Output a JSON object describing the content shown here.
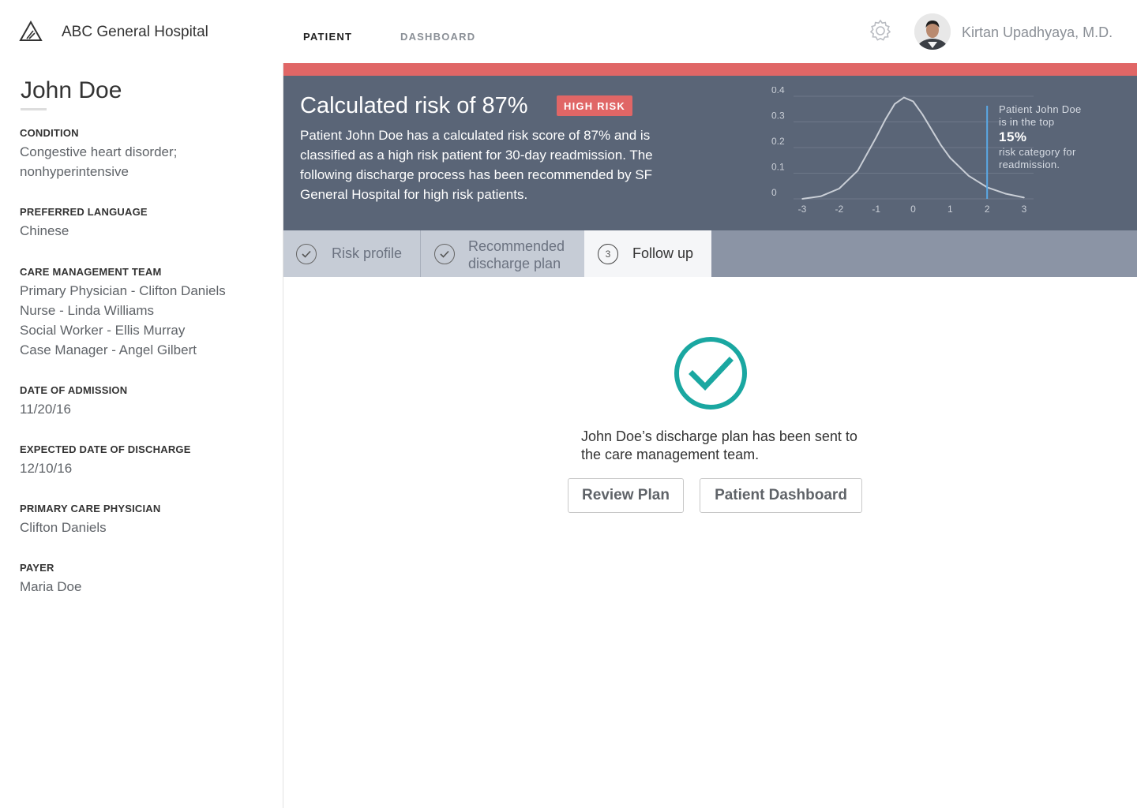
{
  "app": {
    "name": "ABC General Hospital",
    "logo_icon": "triangle-logo-icon"
  },
  "nav": {
    "tabs": [
      {
        "label": "PATIENT",
        "active": true
      },
      {
        "label": "DASHBOARD",
        "active": false
      }
    ]
  },
  "user": {
    "name": "Kirtan Upadhyaya, M.D.",
    "settings_icon": "gear-icon"
  },
  "patient": {
    "name": "John Doe",
    "fields": {
      "condition": {
        "label": "CONDITION",
        "lines": [
          "Congestive heart disorder;",
          "nonhyperintensive"
        ]
      },
      "language": {
        "label": "PREFERRED LANGUAGE",
        "value": "Chinese"
      },
      "care_team": {
        "label": "CARE MANAGEMENT TEAM",
        "lines": [
          "Primary Physician - Clifton Daniels",
          "Nurse - Linda Williams",
          "Social Worker - Ellis Murray",
          "Case Manager - Angel Gilbert"
        ]
      },
      "admission": {
        "label": "DATE OF ADMISSION",
        "value": "11/20/16"
      },
      "discharge": {
        "label": "EXPECTED DATE OF DISCHARGE",
        "value": "12/10/16"
      },
      "pcp": {
        "label": "PRIMARY CARE PHYSICIAN",
        "value": "Clifton Daniels"
      },
      "payer": {
        "label": "PAYER",
        "value": "Maria Doe"
      }
    }
  },
  "risk": {
    "title": "Calculated risk of 87%",
    "badge": "HIGH RISK",
    "description": "Patient John Doe has a calculated risk score of 87% and is classified as a high risk patient for 30-day readmission. The following discharge process has been recommended by SF General Hospital for high risk patients.",
    "annotation": {
      "line1": "Patient John Doe",
      "line2": "is in the top",
      "percent": "15%",
      "line3": "risk category for",
      "line4": "readmission."
    }
  },
  "chart_data": {
    "type": "line",
    "title": "",
    "xlabel": "",
    "ylabel": "",
    "x_ticks": [
      "-3",
      "-2",
      "-1",
      "0",
      "1",
      "2",
      "3"
    ],
    "y_ticks": [
      "0",
      "0.1",
      "0.2",
      "0.3",
      "0.4"
    ],
    "xlim": [
      -3,
      3
    ],
    "ylim": [
      0,
      0.4
    ],
    "x": [
      -3.0,
      -2.5,
      -2.0,
      -1.5,
      -1.0,
      -0.75,
      -0.5,
      -0.25,
      0.0,
      0.25,
      0.5,
      0.75,
      1.0,
      1.5,
      2.0,
      2.5,
      3.0
    ],
    "y": [
      0.0,
      0.01,
      0.04,
      0.11,
      0.24,
      0.31,
      0.37,
      0.395,
      0.38,
      0.33,
      0.27,
      0.21,
      0.16,
      0.09,
      0.045,
      0.02,
      0.005
    ],
    "marker_x": 2.0,
    "grid": true,
    "colors": {
      "line": "#c9ced6",
      "marker": "#5aa9e6",
      "axis_text": "#c9ced6"
    }
  },
  "steps": [
    {
      "label": "Risk profile",
      "status": "done",
      "icon": "check-circle-icon"
    },
    {
      "label_line1": "Recommended",
      "label_line2": "discharge plan",
      "status": "done",
      "icon": "check-circle-icon"
    },
    {
      "label": "Follow up",
      "number": "3",
      "status": "active"
    }
  ],
  "success": {
    "icon": "check-circle-icon",
    "message": "John Doe’s discharge plan has been sent to the care management team.",
    "buttons": {
      "review": "Review Plan",
      "dashboard": "Patient Dashboard"
    }
  },
  "colors": {
    "accent": "#1aa7a1",
    "danger": "#e06666",
    "panel": "#5a6577"
  }
}
